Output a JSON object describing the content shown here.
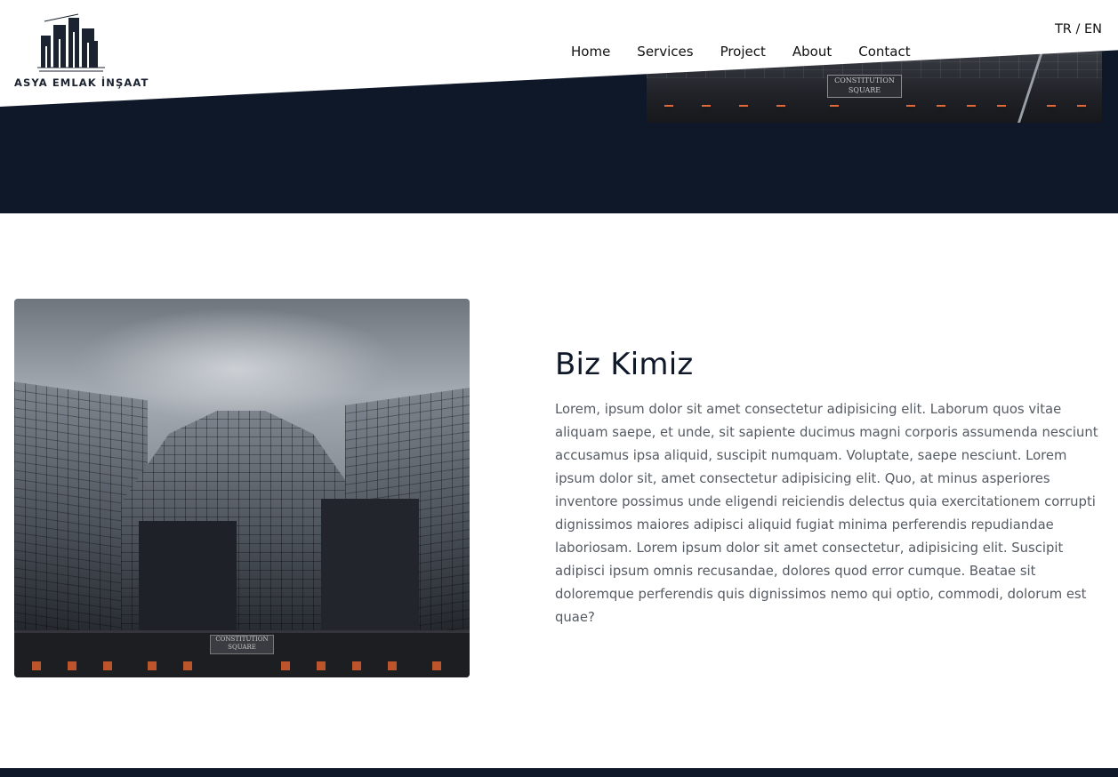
{
  "brand": {
    "logo_text": "ASYA EMLAK İNŞAAT"
  },
  "language": {
    "tr": "TR",
    "separator": "/",
    "en": "EN"
  },
  "nav": {
    "items": [
      {
        "label": "Home"
      },
      {
        "label": "Services"
      },
      {
        "label": "Project"
      },
      {
        "label": "About"
      },
      {
        "label": "Contact"
      }
    ]
  },
  "hero": {
    "sign_text": "CONSTITUTION SQUARE"
  },
  "about": {
    "image_sign_text": "CONSTITUTION SQUARE",
    "title": "Biz Kimiz",
    "body": "Lorem, ipsum dolor sit amet consectetur adipisicing elit. Laborum quos vitae aliquam saepe, et unde, sit sapiente ducimus magni corporis assumenda nesciunt accusamus ipsa aliquid, suscipit numquam. Voluptate, saepe nesciunt. Lorem ipsum dolor sit, amet consectetur adipisicing elit. Quo, at minus asperiores inventore possimus unde eligendi reiciendis delectus quia exercitationem corrupti dignissimos maiores adipisci aliquid fugiat minima perferendis repudiandae laboriosam. Lorem ipsum dolor sit amet consectetur, adipisicing elit. Suscipit adipisci ipsum omnis recusandae, dolores quod error cumque. Beatae sit doloremque perferendis quis dignissimos nemo qui optio, commodi, dolorum est quae?"
  },
  "colors": {
    "navy": "#0f1828",
    "text_body": "#555b63",
    "accent_window": "#d85f2e"
  }
}
